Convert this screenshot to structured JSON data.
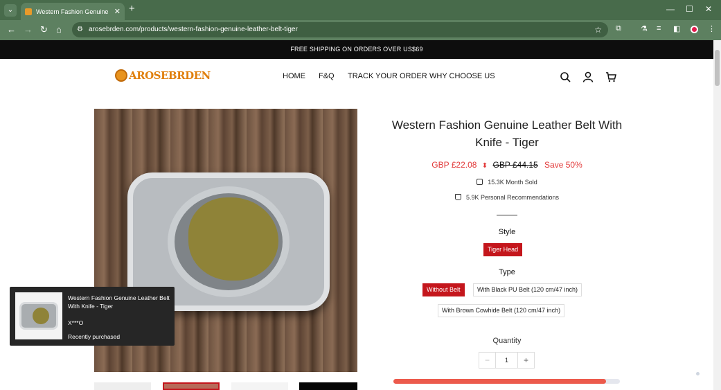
{
  "browser": {
    "tab_title": "Western Fashion Genuine Leather Belt With Knife - Tiger",
    "new_tab": "+",
    "url": "arosebrden.com/products/western-fashion-genuine-leather-belt-tiger",
    "colors": {
      "frame": "#486b4b",
      "toolbar": "#5d8060"
    }
  },
  "announcement": "FREE SHIPPING ON ORDERS OVER US$69",
  "header": {
    "logo_text": "AROSEBRDEN",
    "nav": [
      "HOME",
      "F&Q",
      "TRACK YOUR ORDER",
      "WHY CHOOSE US"
    ],
    "icons": [
      "search-icon",
      "account-icon",
      "cart-icon"
    ]
  },
  "product": {
    "title": "Western Fashion Genuine Leather Belt With Knife - Tiger",
    "price": "GBP £22.08",
    "compare_price": "GBP £44.15",
    "save": "Save 50%",
    "month_sold": "15.3K Month Sold",
    "recommendations": "5.9K Personal Recommendations",
    "style_label": "Style",
    "style_options": [
      "Tiger Head"
    ],
    "type_label": "Type",
    "type_options": [
      "Without Belt",
      "With Black PU Belt (120 cm/47 inch)",
      "With Brown Cowhide Belt (120 cm/47 inch)"
    ],
    "quantity_label": "Quantity",
    "quantity": "1",
    "stock_progress": 0.94,
    "accent_color": "#c4161c"
  },
  "purchase_popup": {
    "title": "Western Fashion Genuine Leather Belt With Knife - Tiger",
    "user": "X***O",
    "when": "Recently purchased"
  }
}
